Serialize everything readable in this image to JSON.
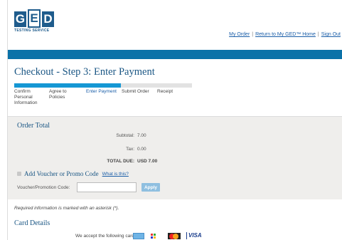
{
  "brand": {
    "letters": [
      "G",
      "E",
      "D"
    ],
    "subtitle": "TESTING SERVICE",
    "colors": {
      "primary": "#1f5c8c",
      "bar": "#0b72a8",
      "accent": "#1597d4",
      "link": "#1a5ea8"
    }
  },
  "header": {
    "links": [
      "My Order",
      "Return to My GED™ Home",
      "Sign Out"
    ],
    "separator": "|"
  },
  "page_title": "Checkout - Step 3: Enter Payment",
  "progress": {
    "fraction": 0.6,
    "steps": [
      "Confirm Personal Information",
      "Agree to Policies",
      "Enter Payment",
      "Submit Order",
      "Receipt"
    ],
    "current": 2
  },
  "order_total": {
    "title": "Order Total",
    "subtotal_label": "Subtotal:",
    "subtotal_value": "7.00",
    "tax_label": "Tax:",
    "tax_value": "0.00",
    "total_label": "TOTAL DUE:",
    "total_value": "USD 7.00"
  },
  "voucher": {
    "heading": "Add Voucher or Promo Code",
    "help_link": "What is this?",
    "field_label": "Voucher/Promotion Code:",
    "field_value": "",
    "apply_label": "Apply",
    "icon": "collapse-square-icon"
  },
  "required_note": "Required information is marked with an asterisk (*).",
  "card_details": {
    "heading": "Card Details",
    "accept_label": "We accept the following cards:",
    "cards": [
      "amex-card-icon",
      "discover-card-icon",
      "mastercard-card-icon",
      "visa-card-icon"
    ],
    "visa_text": "VISA"
  }
}
